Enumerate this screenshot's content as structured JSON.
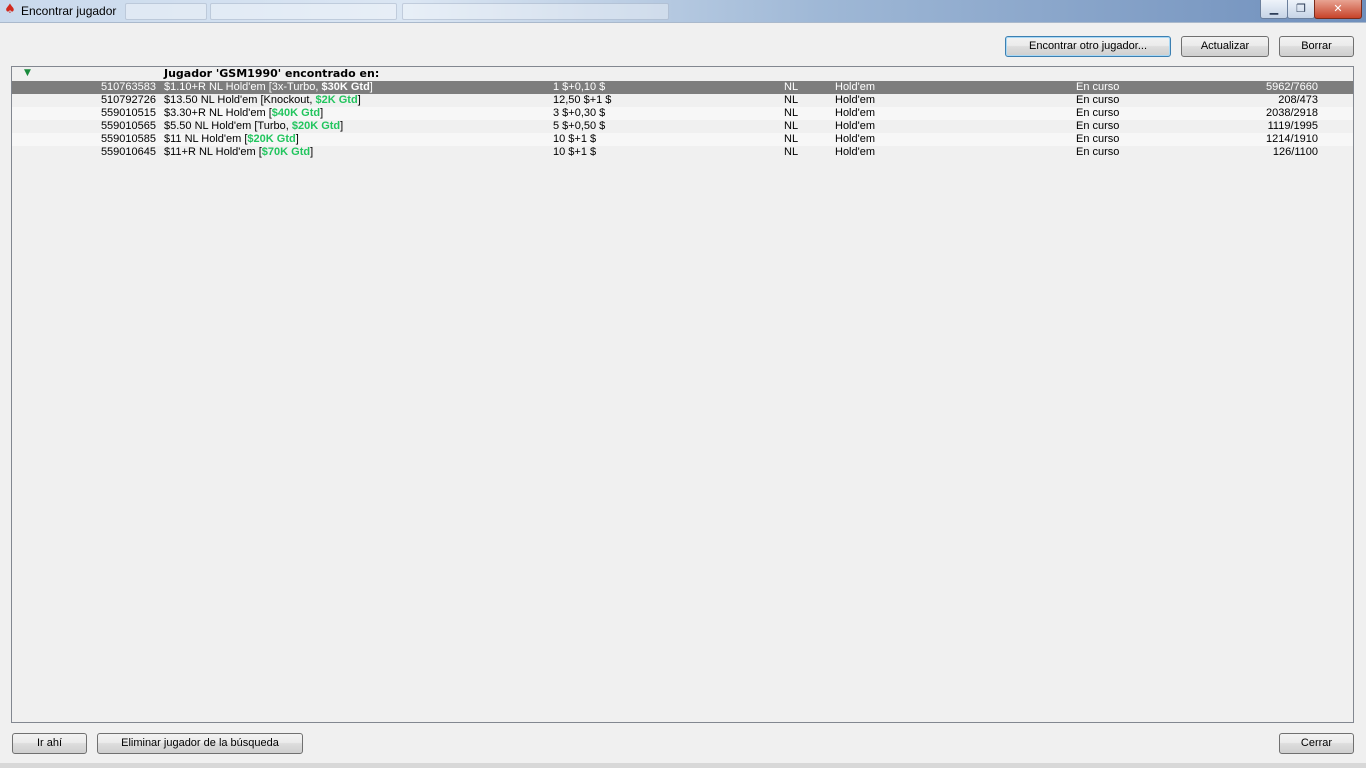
{
  "window": {
    "title": "Encontrar jugador",
    "controls": {
      "minimize": "▁",
      "maximize": "❐",
      "close": "✕"
    }
  },
  "toolbar": {
    "find_other": "Encontrar otro jugador...",
    "refresh": "Actualizar",
    "clear": "Borrar"
  },
  "list": {
    "header": "Jugador 'GSM1990' encontrado en:",
    "rows": [
      {
        "id": "510763583",
        "name_pre": "$1.10+R NL Hold'em [3x-Turbo, ",
        "gtd": "$30K Gtd",
        "name_post": "]",
        "buyin": "1 $+0,10 $",
        "limit": "NL",
        "game": "Hold'em",
        "status": "En curso",
        "players": "5962/7660"
      },
      {
        "id": "510792726",
        "name_pre": "$13.50 NL Hold'em [Knockout, ",
        "gtd": "$2K Gtd",
        "name_post": "]",
        "buyin": "12,50 $+1 $",
        "limit": "NL",
        "game": "Hold'em",
        "status": "En curso",
        "players": "208/473"
      },
      {
        "id": "559010515",
        "name_pre": "$3.30+R NL Hold'em [",
        "gtd": "$40K Gtd",
        "name_post": "]",
        "buyin": "3 $+0,30 $",
        "limit": "NL",
        "game": "Hold'em",
        "status": "En curso",
        "players": "2038/2918"
      },
      {
        "id": "559010565",
        "name_pre": "$5.50 NL Hold'em [Turbo, ",
        "gtd": "$20K Gtd",
        "name_post": "]",
        "buyin": "5 $+0,50 $",
        "limit": "NL",
        "game": "Hold'em",
        "status": "En curso",
        "players": "1119/1995"
      },
      {
        "id": "559010585",
        "name_pre": "$11 NL Hold'em [",
        "gtd": "$20K Gtd",
        "name_post": "]",
        "buyin": "10 $+1 $",
        "limit": "NL",
        "game": "Hold'em",
        "status": "En curso",
        "players": "1214/1910"
      },
      {
        "id": "559010645",
        "name_pre": "$11+R NL Hold'em [",
        "gtd": "$70K Gtd",
        "name_post": "]",
        "buyin": "10 $+1 $",
        "limit": "NL",
        "game": "Hold'em",
        "status": "En curso",
        "players": "126/1100"
      }
    ]
  },
  "footer": {
    "go_there": "Ir ahí",
    "remove_player": "Eliminar jugador de la búsqueda",
    "close": "Cerrar"
  },
  "colors": {
    "guaranteed_text": "#22c55e",
    "selected_row_bg": "#7d7d7d",
    "app_icon": "#d12a1e"
  },
  "icons": {
    "app": "pokerstars-spade-icon",
    "sort": "sort-arrow-icon"
  }
}
